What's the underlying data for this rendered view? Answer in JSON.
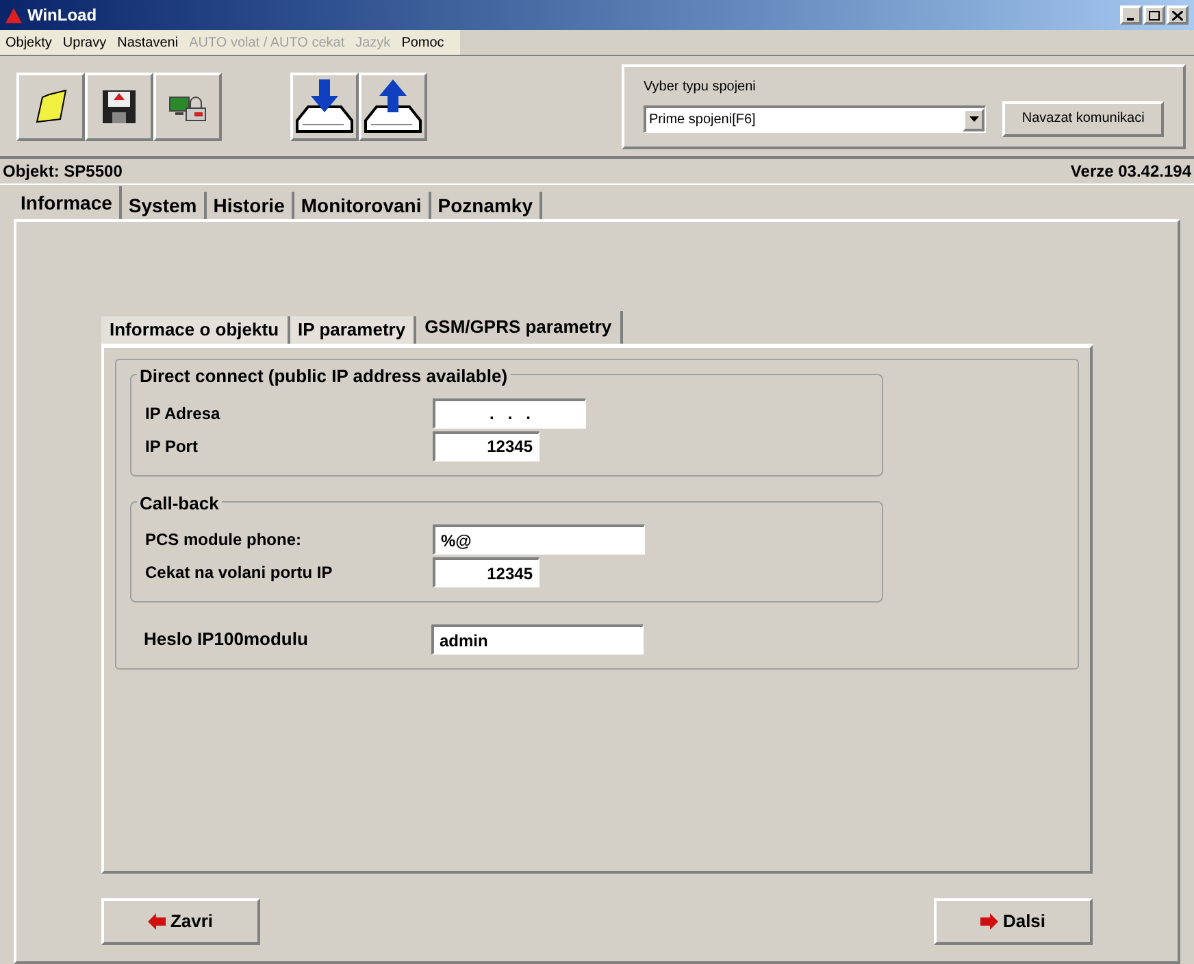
{
  "window": {
    "title": "WinLoad"
  },
  "menu": [
    {
      "label": "Objekty",
      "disabled": false
    },
    {
      "label": "Upravy",
      "disabled": false
    },
    {
      "label": "Nastaveni",
      "disabled": false
    },
    {
      "label": "AUTO volat / AUTO cekat",
      "disabled": true
    },
    {
      "label": "Jazyk",
      "disabled": true
    },
    {
      "label": "Pomoc",
      "disabled": false
    }
  ],
  "connection": {
    "label": "Vyber typu spojeni",
    "value": "Prime spojeni[F6]",
    "button": "Navazat komunikaci"
  },
  "object_bar": {
    "object": "Objekt: SP5500",
    "version": "Verze 03.42.194"
  },
  "tabs": [
    {
      "label": "Informace",
      "selected": true
    },
    {
      "label": "System",
      "selected": false
    },
    {
      "label": "Historie",
      "selected": false
    },
    {
      "label": "Monitorovani",
      "selected": false
    },
    {
      "label": "Poznamky",
      "selected": false
    }
  ],
  "subtabs": [
    {
      "label": "Informace o objektu",
      "selected": false
    },
    {
      "label": "IP parametry",
      "selected": false
    },
    {
      "label": "GSM/GPRS parametry",
      "selected": true
    }
  ],
  "groups": [
    {
      "title": "Direct connect (public IP address available)",
      "fields": [
        {
          "label": "IP Adresa",
          "value": " .   .   . ",
          "kind": "ip"
        },
        {
          "label": "IP Port",
          "value": "12345",
          "kind": "number"
        }
      ]
    },
    {
      "title": "Call-back",
      "fields": [
        {
          "label": "PCS module phone:",
          "value": "%@",
          "kind": "text"
        },
        {
          "label": "Cekat na volani portu IP",
          "value": "12345",
          "kind": "number"
        }
      ]
    }
  ],
  "password": {
    "label": "Heslo IP100modulu",
    "value": "admin"
  },
  "buttons": [
    {
      "label": "Zavri",
      "kind": "back"
    },
    {
      "label": "Dalsi",
      "kind": "next"
    }
  ]
}
